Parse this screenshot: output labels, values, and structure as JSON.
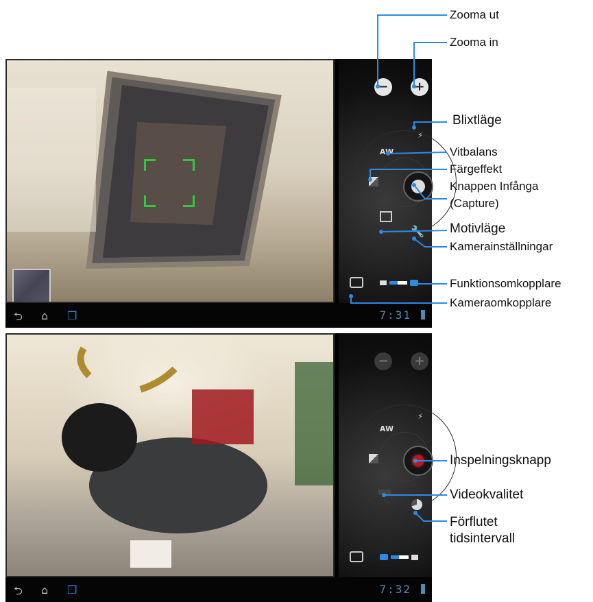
{
  "callouts": {
    "zoom_out": "Zooma ut",
    "zoom_in": "Zooma in",
    "flash_mode": "Blixtläge",
    "white_balance": "Vitbalans",
    "color_effect": "Färgeffekt",
    "capture_button_line1": "Knappen Infånga",
    "capture_button_line2": "(Capture)",
    "scene_mode": "Motivläge",
    "camera_settings": "Kamerainställningar",
    "function_switch": "Funktionsomkopplare",
    "camera_switch": "Kameraomkopplare",
    "record_button": "Inspelningsknapp",
    "video_quality": "Videokvalitet",
    "time_lapse_line1": "Förflutet",
    "time_lapse_line2": "tidsintervall"
  },
  "screen1": {
    "clock": "7:31"
  },
  "screen2": {
    "clock": "7:32"
  },
  "icons": {
    "white_balance": "AW",
    "back": "back-icon",
    "home": "home-icon",
    "recent_apps": "recent-apps-icon"
  },
  "colors": {
    "accent": "#2a8be6",
    "record": "#c0171e",
    "focus": "#2ec93f",
    "callout_line": "#2a8be6"
  }
}
